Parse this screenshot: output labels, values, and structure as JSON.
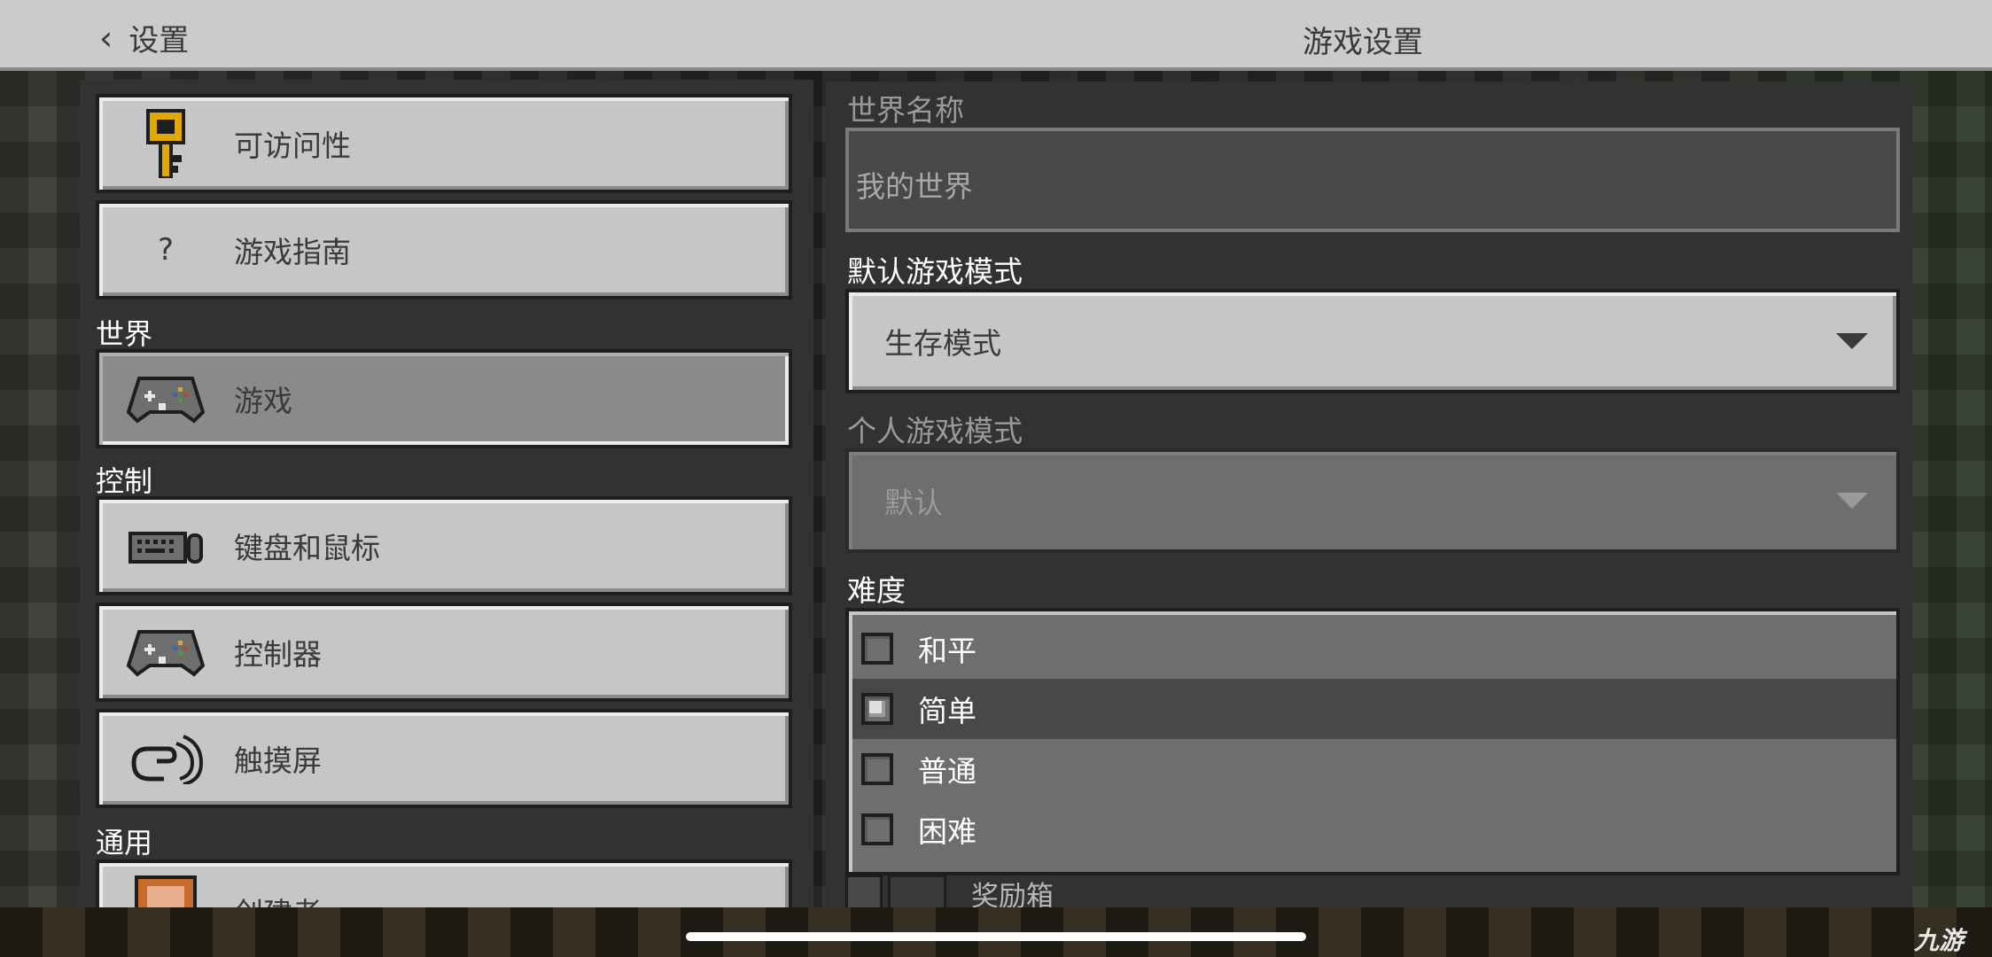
{
  "header": {
    "back_label": "设置",
    "title": "游戏设置"
  },
  "sidebar": {
    "items_top": [
      {
        "label": "可访问性",
        "icon": "key-icon"
      },
      {
        "label": "游戏指南",
        "icon": "question-icon",
        "glyph": "?"
      }
    ],
    "section_world": "世界",
    "world_items": [
      {
        "label": "游戏",
        "icon": "controller-icon",
        "selected": true
      }
    ],
    "section_controls": "控制",
    "control_items": [
      {
        "label": "键盘和鼠标",
        "icon": "keyboard-mouse-icon"
      },
      {
        "label": "控制器",
        "icon": "controller-icon"
      },
      {
        "label": "触摸屏",
        "icon": "touch-icon"
      }
    ],
    "section_general": "通用",
    "general_items": [
      {
        "label": "创建者",
        "icon": "creator-icon"
      }
    ]
  },
  "form": {
    "world_name_label": "世界名称",
    "world_name_value": "我的世界",
    "default_mode_label": "默认游戏模式",
    "default_mode_value": "生存模式",
    "personal_mode_label": "个人游戏模式",
    "personal_mode_value": "默认",
    "difficulty_label": "难度",
    "difficulty_options": [
      "和平",
      "简单",
      "普通",
      "困难"
    ],
    "difficulty_selected": "简单",
    "next_toggle_label": "奖励箱"
  },
  "overlay": {
    "watermark": "九游"
  },
  "colors": {
    "panel": "#313233",
    "button": "#c6c6c6",
    "selected": "#8a8a8a",
    "key_gold": "#e0a800"
  }
}
